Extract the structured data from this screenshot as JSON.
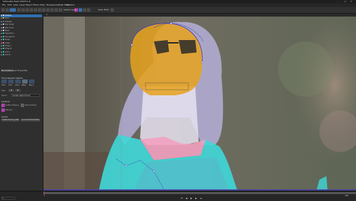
{
  "window": {
    "title": "Silhouette Paint [2023.5.1]",
    "controls": [
      "–",
      "□",
      "✕"
    ]
  },
  "menu": [
    "File",
    "Edit",
    "View",
    "Layer",
    "Object",
    "Filters",
    "Help",
    "Workspace/Mask Mode",
    "Window"
  ],
  "toolbar": {
    "view_label": "Select Layer",
    "zoom_label": "View: Both",
    "frame_label": "0"
  },
  "layers": [
    {
      "label": "Shapes",
      "color": "#e0e0e0",
      "selected": true
    },
    {
      "label": "Face",
      "color": "#e0a020",
      "selected": false
    },
    {
      "label": "Glasses",
      "color": "#4070d0",
      "selected": false
    },
    {
      "label": "Hair Outer",
      "color": "#c0c0ff",
      "selected": false
    },
    {
      "label": "Hair Inner",
      "color": "#c0c0ff",
      "selected": false
    },
    {
      "label": "Neck",
      "color": "#d0d0d0",
      "selected": false
    },
    {
      "label": "Shoulder L",
      "color": "#30c0c0",
      "selected": false
    },
    {
      "label": "Shoulder R",
      "color": "#30c0c0",
      "selected": false
    },
    {
      "label": "Dress",
      "color": "#30c0c0",
      "selected": false
    },
    {
      "label": "Collar",
      "color": "#ff70a0",
      "selected": false
    },
    {
      "label": "Strap L",
      "color": "#30c0c0",
      "selected": false
    },
    {
      "label": "Strap R",
      "color": "#30c0c0",
      "selected": false
    },
    {
      "label": "Arm L",
      "color": "#30c0c0",
      "selected": false
    },
    {
      "label": "Arm R",
      "color": "#30c0c0",
      "selected": false
    }
  ],
  "panel_tabs": [
    "Parameters",
    "Layer Properties"
  ],
  "tools_section": "Track selected objects",
  "tool_buttons": [
    "Track",
    "Track",
    "Move",
    "Offset",
    "Blend"
  ],
  "track_fields": {
    "label": "Track",
    "mode_label": "Link to:",
    "mode_value": "Tracked Object Frame"
  },
  "surface_section": "Surfaces",
  "surface_items": [
    {
      "label": "Surface Tracking",
      "color": "#b040b0"
    },
    {
      "label": "Track Surfaces",
      "color": "#606060"
    },
    {
      "label": "Edit Surf",
      "color": "#b040b0"
    }
  ],
  "layers_section": "Layers",
  "layer_buttons": [
    "Create Tracking Data",
    "Convert Tracked Data"
  ],
  "timeline": {
    "start": "1",
    "end": "240",
    "current": "1"
  },
  "colors": {
    "accent": "#2e6fb0",
    "face_mask": "#e6a21c",
    "body_mask": "#3fd8d8",
    "hair_mask": "#bfb8e8",
    "collar_mask": "#f2a0c0",
    "spline": "#3838c0"
  }
}
